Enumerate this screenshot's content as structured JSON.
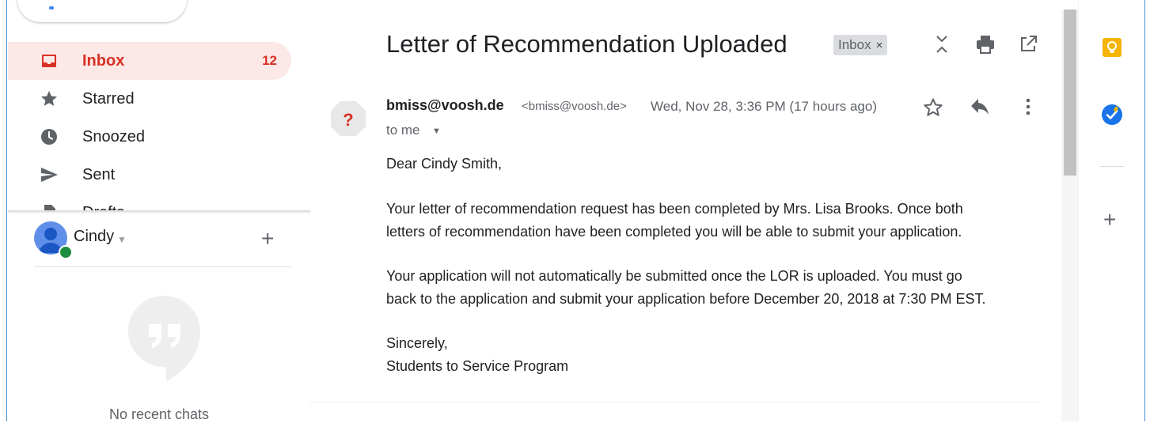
{
  "nav": {
    "items": [
      {
        "label": "Inbox",
        "count": "12"
      },
      {
        "label": "Starred"
      },
      {
        "label": "Snoozed"
      },
      {
        "label": "Sent"
      },
      {
        "label": "Drafts"
      }
    ]
  },
  "hangouts": {
    "user": "Cindy",
    "empty_text": "No recent chats"
  },
  "email": {
    "subject": "Letter of Recommendation Uploaded",
    "label": "Inbox",
    "label_close": "×",
    "sender_name": "bmiss@voosh.de",
    "sender_email": "<bmiss@voosh.de>",
    "date": "Wed, Nov 28, 3:36 PM (17 hours ago)",
    "to": "to me",
    "avatar_mark": "?",
    "body": [
      "Dear Cindy Smith,",
      "Your letter of recommendation request has been completed by Mrs. Lisa Brooks.  Once both",
      "letters of recommendation have been completed you will be able to submit your application.",
      "Your application will not automatically be submitted once the LOR is uploaded. You must go",
      "back to the application and submit your application before December 20, 2018 at 7:30 PM EST.",
      "Sincerely,",
      "Students to Service Program"
    ]
  },
  "colors": {
    "accent_red": "#d93025",
    "active_bg": "#fce8e6",
    "keep_yellow": "#f4b400",
    "tasks_blue": "#1a73e8"
  },
  "icons": {
    "nav": [
      "inbox-icon",
      "star-icon",
      "clock-icon",
      "send-icon",
      "draft-icon"
    ],
    "toolbar": [
      "expand-collapse-icon",
      "print-icon",
      "open-new-window-icon"
    ],
    "message": [
      "star-outline-icon",
      "reply-icon",
      "more-vert-icon"
    ],
    "side": [
      "keep-icon",
      "tasks-icon",
      "add-icon"
    ]
  }
}
